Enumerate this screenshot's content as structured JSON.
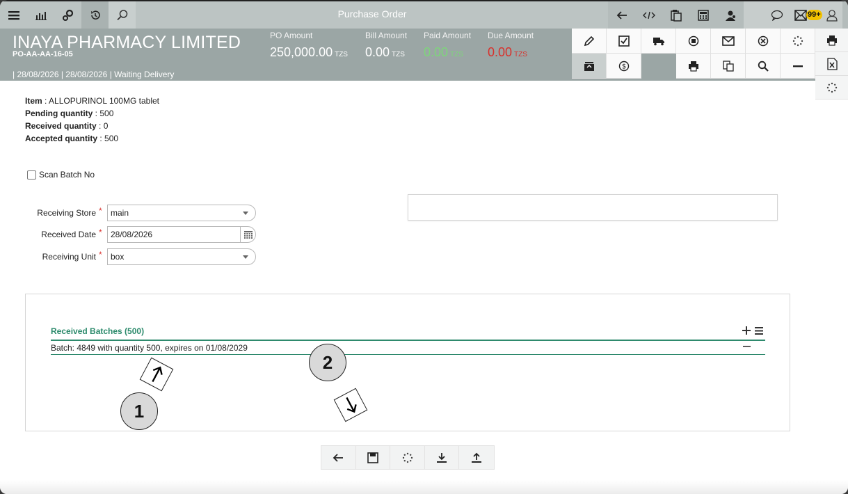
{
  "toolbar": {
    "title": "Purchase Order",
    "left_icons": [
      "menu-icon",
      "chart-icon",
      "settings-icon",
      "history-icon",
      "search-icon"
    ],
    "right_icons": [
      "back-icon",
      "code-icon",
      "clipboard-icon",
      "calculator-icon",
      "user-support-icon",
      "chat-icon",
      "mail-icon",
      "user-icon"
    ],
    "notification_count": "99+"
  },
  "header": {
    "company": "INAYA PHARMACY LIMITED",
    "po_number": "PO-AA-AA-16-05",
    "meta": "| 28/08/2026 | 28/08/2026 | Waiting Delivery",
    "amounts": [
      {
        "label": "PO Amount",
        "value": "250,000.00",
        "currency": "TZS"
      },
      {
        "label": "Bill Amount",
        "value": "0.00",
        "currency": "TZS"
      },
      {
        "label": "Paid Amount",
        "value": "0.00",
        "currency": "TZS"
      },
      {
        "label": "Due Amount",
        "value": "0.00",
        "currency": "TZS"
      }
    ],
    "action_icons_row1": [
      "edit-icon",
      "approve-icon",
      "delivery-icon",
      "stop-icon",
      "mail-icon",
      "cancel-icon",
      "loading-icon"
    ],
    "action_icons_row2": [
      "archive-icon",
      "payment-icon",
      "print-icon",
      "copy-icon",
      "search-icon",
      "minus-icon"
    ],
    "side_icons": [
      "print-icon",
      "excel-icon",
      "loading-icon"
    ],
    "colors": {
      "paid": "#7dd67a",
      "due": "#d9302b",
      "header_bg": "#9ba6a5"
    }
  },
  "item": {
    "item_label": "Item",
    "item_value": "ALLOPURINOL 100MG tablet",
    "pending_label": "Pending quantity",
    "pending_value": "500",
    "received_label": "Received quantity",
    "received_value": "0",
    "accepted_label": "Accepted quantity",
    "accepted_value": "500"
  },
  "scan": {
    "label": "Scan Batch No",
    "checked": false
  },
  "form": {
    "store_label": "Receiving Store",
    "store_value": "main",
    "date_label": "Received Date",
    "date_value": "28/08/2026",
    "unit_label": "Receiving Unit",
    "unit_value": "box",
    "required_mark": "*"
  },
  "batches": {
    "title": "Received Batches (500)",
    "rows": [
      "Batch: 4849 with quantity 500, expires on 01/08/2029"
    ]
  },
  "annotations": {
    "marker1": "1",
    "marker2": "2"
  },
  "bottom_icons": [
    "back-icon",
    "save-icon",
    "loading-icon",
    "download-icon",
    "upload-icon"
  ]
}
